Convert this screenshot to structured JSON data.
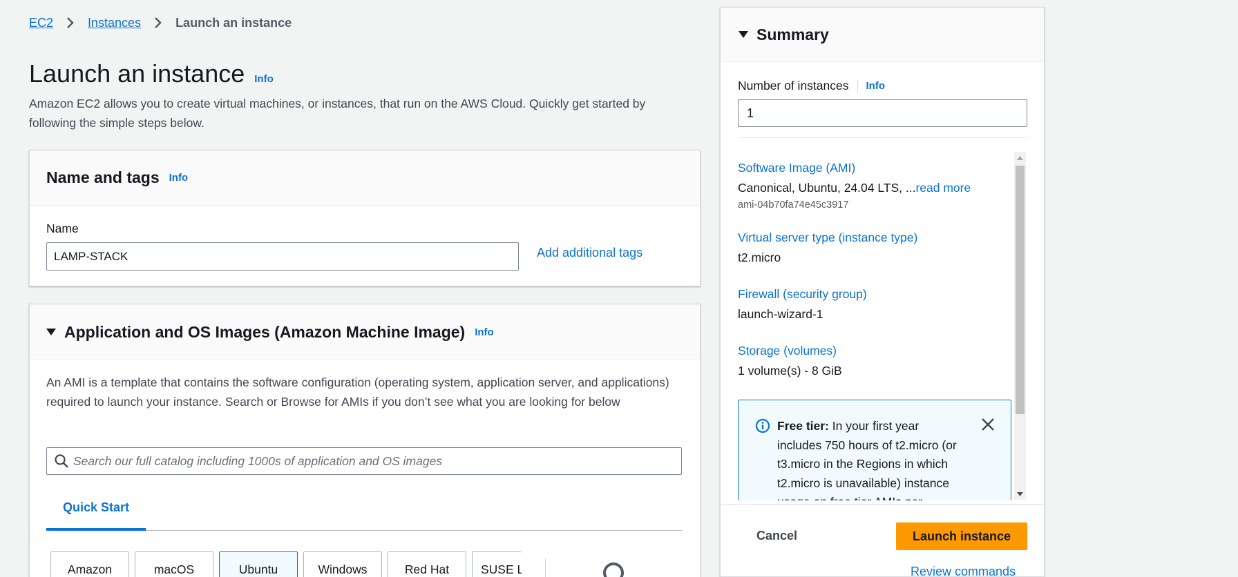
{
  "breadcrumb": {
    "items": [
      "EC2",
      "Instances"
    ],
    "current": "Launch an instance"
  },
  "header": {
    "title": "Launch an instance",
    "info": "Info",
    "description": "Amazon EC2 allows you to create virtual machines, or instances, that run on the AWS Cloud. Quickly get started by following the simple steps below."
  },
  "name_tags": {
    "title": "Name and tags",
    "info": "Info",
    "name_label": "Name",
    "name_value": "LAMP-STACK",
    "add_tags": "Add additional tags"
  },
  "ami": {
    "title": "Application and OS Images (Amazon Machine Image)",
    "info": "Info",
    "description": "An AMI is a template that contains the software configuration (operating system, application server, and applications) required to launch your instance. Search or Browse for AMIs if you don’t see what you are looking for below",
    "search_placeholder": "Search our full catalog including 1000s of application and OS images",
    "tab": "Quick Start",
    "os_tiles": [
      "Amazon",
      "macOS",
      "Ubuntu",
      "Windows",
      "Red Hat",
      "SUSE Li"
    ],
    "selected_tile": "Ubuntu"
  },
  "summary": {
    "title": "Summary",
    "num_label": "Number of instances",
    "info": "Info",
    "num_value": "1",
    "ami_label": "Software Image (AMI)",
    "ami_value": "Canonical, Ubuntu, 24.04 LTS, ...",
    "ami_read_more": "read more",
    "ami_id": "ami-04b70fa74e45c3917",
    "type_label": "Virtual server type (instance type)",
    "type_value": "t2.micro",
    "firewall_label": "Firewall (security group)",
    "firewall_value": "launch-wizard-1",
    "storage_label": "Storage (volumes)",
    "storage_value": "1 volume(s) - 8 GiB",
    "free_tier_bold": "Free tier:",
    "free_tier_text": " In your first year includes 750 hours of t2.micro (or t3.micro in the Regions in which t2.micro is unavailable) instance usage on free tier AMIs per",
    "cancel": "Cancel",
    "launch": "Launch instance",
    "review": "Review commands"
  },
  "colors": {
    "link": "#0972d3",
    "primary_button": "#ff9900",
    "background": "#f2f3f3"
  }
}
